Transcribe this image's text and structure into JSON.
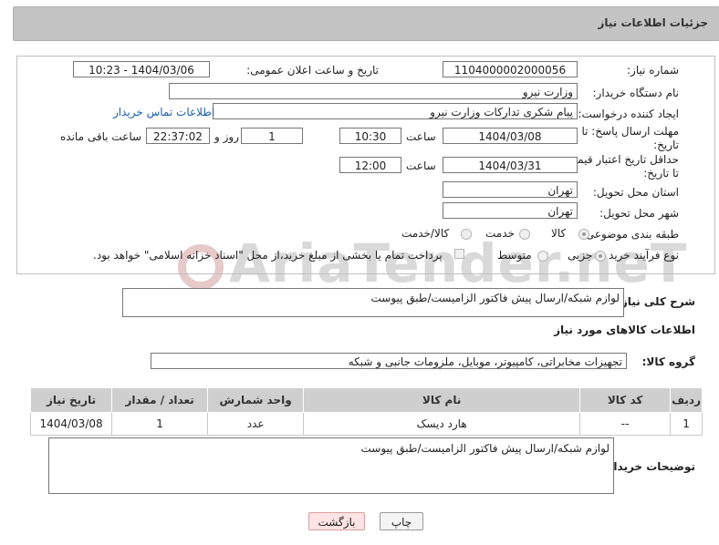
{
  "header": {
    "title": "جزئیات اطلاعات نیاز"
  },
  "watermark": "AriaTender.neT",
  "form": {
    "need_number_label": "شماره نیاز:",
    "need_number": "1104000002000056",
    "announce_label": "تاریخ و ساعت اعلان عمومی:",
    "announce_value": "1404/03/06 - 10:23",
    "buyer_org_label": "نام دستگاه خریدار:",
    "buyer_org": "وزارت نیرو",
    "creator_label": "ایجاد کننده درخواست:",
    "creator": "پیام شکری تدارکات وزارت نیرو",
    "buyer_contact_link": "اطلاعات تماس خریدار",
    "deadline_label": "مهلت ارسال پاسخ: تا تاریخ:",
    "deadline_date": "1404/03/08",
    "time_label": "ساعت",
    "deadline_time": "10:30",
    "days_value": "1",
    "days_label": "روز و",
    "remaining_value": "22:37:02",
    "remaining_label": "ساعت باقی مانده",
    "price_validity_label": "حداقل تاریخ اعتبار قیمت: تا تاریخ:",
    "price_validity_date": "1404/03/31",
    "price_validity_time": "12:00",
    "province_label": "استان محل تحویل:",
    "province": "تهران",
    "city_label": "شهر محل تحویل:",
    "city": "تهران",
    "category_label": "طبقه بندی موضوعی:",
    "category_options": [
      "کالا",
      "خدمت",
      "کالا/خدمت"
    ],
    "process_label": "نوع فرآیند خرید :",
    "process_options": [
      "جزیی",
      "متوسط"
    ],
    "payment_note": "پرداخت تمام یا بخشی از مبلغ خرید،از محل \"اسناد خزانه اسلامی\" خواهد بود."
  },
  "summary": {
    "label": "شرح کلی نیاز:",
    "value": "لوازم شبکه/ارسال پیش فاکتور الزامیست/طبق پیوست"
  },
  "goods": {
    "section_title": "اطلاعات کالاهای مورد نیاز",
    "group_label": "گروه کالا:",
    "group_value": "تجهیزات مخابراتی، کامپیوتر، موبایل، ملزومات جانبی و شبکه"
  },
  "table": {
    "headers": [
      "ردیف",
      "کد کالا",
      "نام کالا",
      "واحد شمارش",
      "تعداد / مقدار",
      "تاریخ نیاز"
    ],
    "rows": [
      [
        "1",
        "--",
        "هارد دیسک",
        "عدد",
        "1",
        "1404/03/08"
      ]
    ]
  },
  "buyer_notes": {
    "label": "توضیحات خریدار:",
    "value": "لوازم شبکه/ارسال پیش فاکتور الزامیست/طبق پیوست"
  },
  "buttons": {
    "print": "چاپ",
    "back": "بازگشت"
  }
}
